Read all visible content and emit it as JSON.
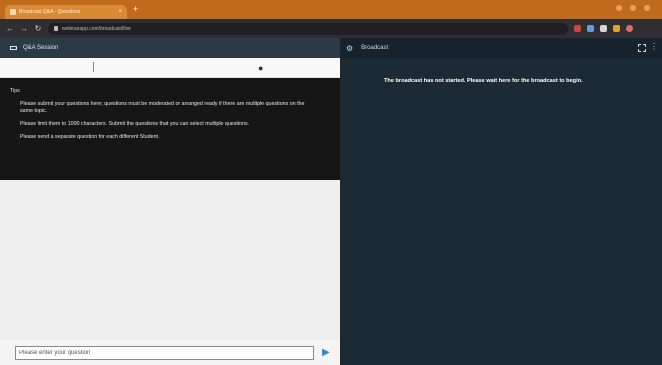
{
  "browser": {
    "tab_title": "Broadcast Q&A · Questions",
    "tab_close": "×",
    "new_tab": "+",
    "address": "webinarapp.com/broadcast/live"
  },
  "left_panel": {
    "header_title": "Q&A Session"
  },
  "notes": {
    "label": "Tips",
    "lines": [
      "Please submit your questions here; questions must be moderated or arranged ready if there are multiple questions on the same topic.",
      "Please limit them to 1000 characters. Submit the questions that you can select multiple questions.",
      "Please send a separate question for each different Student."
    ]
  },
  "question_input": {
    "placeholder": "Please enter your question"
  },
  "broadcast": {
    "title": "Broadcast",
    "message": "The broadcast has not started. Please wait here for the broadcast to begin."
  },
  "colors": {
    "tabstrip": "#c06a1c",
    "dark_panel": "#1c2a36",
    "accent": "#2d8ad1"
  }
}
